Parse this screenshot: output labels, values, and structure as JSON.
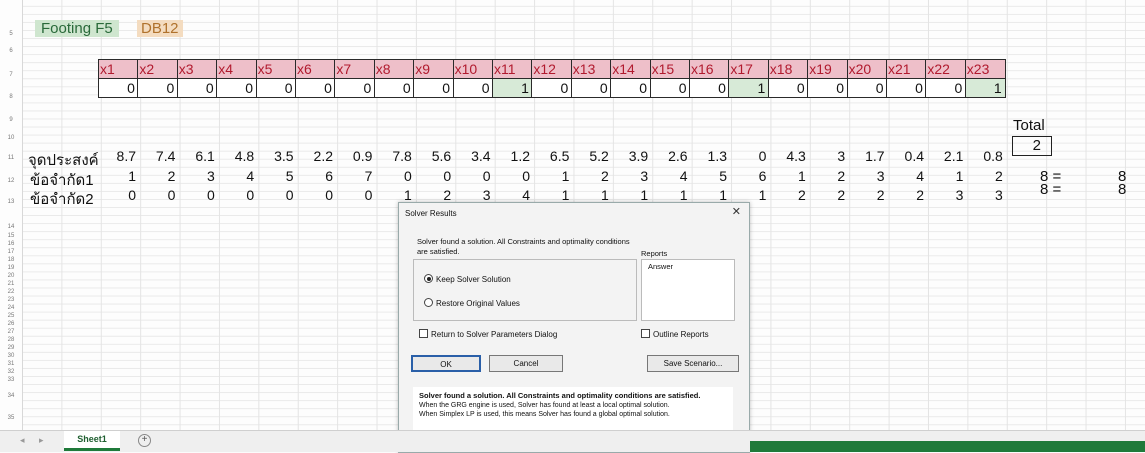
{
  "sheet": {
    "row_numbers": [
      "5",
      "6",
      "7",
      "8",
      "9",
      "10",
      "11",
      "12",
      "13",
      "14",
      "15",
      "16",
      "17",
      "18",
      "19",
      "20",
      "21",
      "22",
      "23",
      "24",
      "25",
      "26",
      "27",
      "28",
      "29",
      "30",
      "31",
      "32",
      "33",
      "34",
      "35"
    ],
    "title1": "Footing F5",
    "title2": "DB12",
    "var_headers": [
      "x1",
      "x2",
      "x3",
      "x4",
      "x5",
      "x6",
      "x7",
      "x8",
      "x9",
      "x10",
      "x11",
      "x12",
      "x13",
      "x14",
      "x15",
      "x16",
      "x17",
      "x18",
      "x19",
      "x20",
      "x21",
      "x22",
      "x23"
    ],
    "var_values": [
      "0",
      "0",
      "0",
      "0",
      "0",
      "0",
      "0",
      "0",
      "0",
      "0",
      "1",
      "0",
      "0",
      "0",
      "0",
      "0",
      "1",
      "0",
      "0",
      "0",
      "0",
      "0",
      "1"
    ],
    "total_label": "Total",
    "objective_label": "จุดประสงค์",
    "objective_values": [
      "8.7",
      "7.4",
      "6.1",
      "4.8",
      "3.5",
      "2.2",
      "0.9",
      "7.8",
      "5.6",
      "3.4",
      "1.2",
      "6.5",
      "5.2",
      "3.9",
      "2.6",
      "1.3",
      "0",
      "4.3",
      "3",
      "1.7",
      "0.4",
      "2.1",
      "0.8"
    ],
    "objective_total": "2",
    "constraint1_label": "ข้อจำกัด1",
    "constraint1_values": [
      "1",
      "2",
      "3",
      "4",
      "5",
      "6",
      "7",
      "0",
      "0",
      "0",
      "0",
      "1",
      "2",
      "3",
      "4",
      "5",
      "6",
      "1",
      "2",
      "3",
      "4",
      "1",
      "2"
    ],
    "constraint1_lhs": "8 =",
    "constraint1_rhs": "8",
    "constraint2_label": "ข้อจำกัด2",
    "constraint2_values": [
      "0",
      "0",
      "0",
      "0",
      "0",
      "0",
      "0",
      "1",
      "2",
      "3",
      "4",
      "1",
      "1",
      "1",
      "1",
      "1",
      "1",
      "2",
      "2",
      "2",
      "2",
      "3",
      "3"
    ],
    "constraint2_lhs": "8 =",
    "constraint2_rhs": "8"
  },
  "dialog": {
    "title": "Solver Results",
    "close_glyph": "✕",
    "message": "Solver found a solution.  All Constraints and optimality conditions are satisfied.",
    "keep_label": "Keep Solver Solution",
    "restore_label": "Restore Original Values",
    "reports_label": "Reports",
    "reports_item": "Answer",
    "return_label": "Return to Solver Parameters Dialog",
    "outline_label": "Outline Reports",
    "ok_label": "OK",
    "cancel_label": "Cancel",
    "save_label": "Save Scenario...",
    "footer_bold": "Solver found a solution.  All Constraints and optimality conditions are satisfied.",
    "footer_line1": "When the GRG engine is used, Solver has found at least a local optimal solution.",
    "footer_line2": "When Simplex LP is used, this means Solver has found a global optimal solution."
  },
  "bottom": {
    "tab_nav": "◂ ▸",
    "sheet_tab": "Sheet1",
    "add_sheet": "+"
  },
  "colors": {
    "header_fill": "#eebfc9",
    "header_text": "#b11a2e",
    "selected_var_fill": "#d7ead7",
    "status_bar": "#1f7a3a"
  }
}
